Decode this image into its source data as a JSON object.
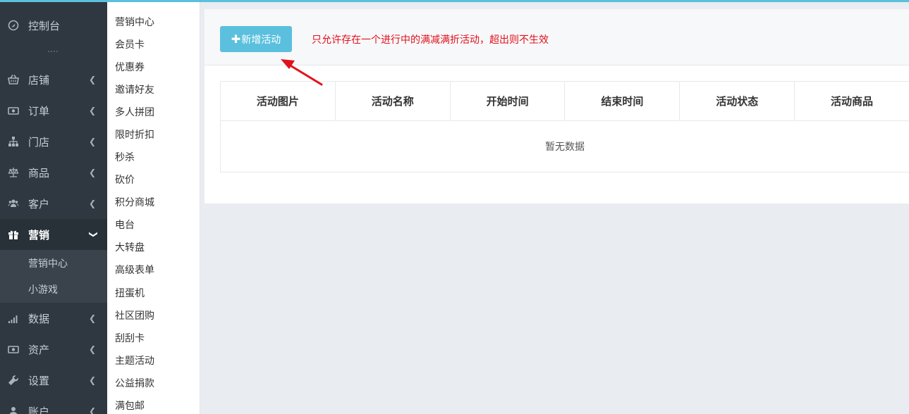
{
  "sidebar": {
    "items": [
      {
        "label": "控制台",
        "icon": "dashboard-icon"
      },
      {
        "label": "店铺",
        "icon": "basket-icon"
      },
      {
        "label": "订单",
        "icon": "money-icon"
      },
      {
        "label": "门店",
        "icon": "sitemap-icon"
      },
      {
        "label": "商品",
        "icon": "balance-scale-icon"
      },
      {
        "label": "客户",
        "icon": "users-icon"
      },
      {
        "label": "营销",
        "icon": "gift-icon"
      },
      {
        "label": "数据",
        "icon": "signal-icon"
      },
      {
        "label": "资产",
        "icon": "money-icon"
      },
      {
        "label": "设置",
        "icon": "wrench-icon"
      },
      {
        "label": "账户",
        "icon": "user-icon"
      }
    ],
    "marketing_sub": [
      {
        "label": "营销中心"
      },
      {
        "label": "小游戏"
      }
    ]
  },
  "submenu": {
    "items": [
      "营销中心",
      "会员卡",
      "优惠券",
      "邀请好友",
      "多人拼团",
      "限时折扣",
      "秒杀",
      "砍价",
      "积分商城",
      "电台",
      "大转盘",
      "高级表单",
      "扭蛋机",
      "社区团购",
      "刮刮卡",
      "主题活动",
      "公益捐款",
      "满包邮"
    ]
  },
  "toolbar": {
    "add_label": "新增活动",
    "notice": "只允许存在一个进行中的满减满折活动，超出则不生效"
  },
  "table": {
    "headers": [
      "活动图片",
      "活动名称",
      "开始时间",
      "结束时间",
      "活动状态",
      "活动商品"
    ],
    "empty_text": "暂无数据"
  },
  "colors": {
    "accent": "#5bc0de",
    "sidebar_bg": "#2f3740",
    "notice": "#e0111b"
  }
}
